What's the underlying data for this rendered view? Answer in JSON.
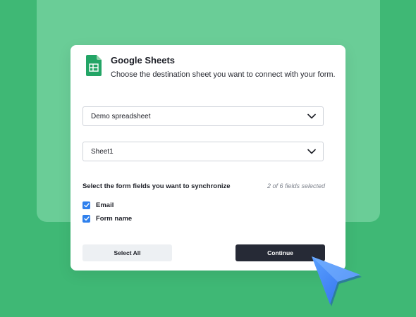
{
  "dialog": {
    "title": "Google Sheets",
    "subtitle": "Choose the destination sheet you want to connect with your form.",
    "icon": "google-sheets-icon"
  },
  "spreadsheet_select": {
    "value": "Demo spreadsheet"
  },
  "sheet_select": {
    "value": "Sheet1"
  },
  "fields": {
    "heading": "Select the form fields you want to synchronize",
    "count": "2 of 6 fields selected",
    "items": [
      {
        "label": "Email",
        "checked": true
      },
      {
        "label": "Form name",
        "checked": true
      }
    ]
  },
  "buttons": {
    "select_all": "Select All",
    "continue": "Continue"
  },
  "colors": {
    "background": "#3fb875",
    "backdrop": "#6acd97",
    "accent": "#2f80ed",
    "primary_button": "#262a36",
    "sheets_green": "#23a566"
  }
}
